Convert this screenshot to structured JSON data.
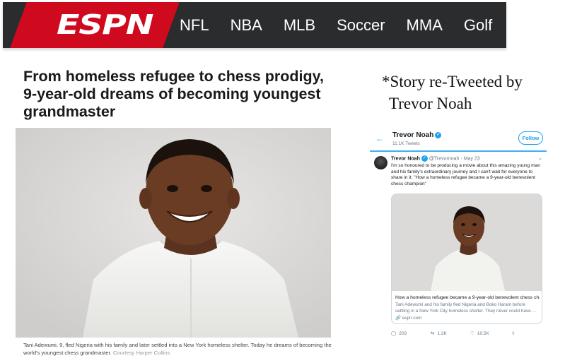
{
  "espn": {
    "logo": "ESPN",
    "nav": [
      "NFL",
      "NBA",
      "MLB",
      "Soccer",
      "MMA",
      "Golf"
    ],
    "brand_red": "#d00a1e",
    "bar_color": "#2b2c2d"
  },
  "article": {
    "headline": "From homeless refugee to chess prodigy, 9-year-old dreams of becoming youngest grandmaster",
    "caption": "Tani Adewumi, 9, fled Nigeria with his family and later settled into a New York homeless shelter. Today he dreams of becoming the world's youngest chess grandmaster.",
    "credit": "Courtesy Harper Collins"
  },
  "note": {
    "line1": "*Story re-Tweeted by",
    "line2": "Trevor Noah"
  },
  "tweet": {
    "profile_name": "Trevor Noah",
    "tweet_count": "11.1K Tweets",
    "follow_label": "Follow",
    "author": "Trevor Noah",
    "handle": "@Trevornoah",
    "date": "May 23",
    "text": "I'm so honoured to be producing a movie about this amazing young man and his family's extraordinary journey and I can't wait for everyone to share in it. \"How a homeless refugee became a 9-year-old benevolent chess champion\"",
    "card_title": "How a homeless refugee became a 9-year-old benevolent chess cha...",
    "card_desc": "Tani Adewumi and his family fled Nigeria and Boko Haram before settling in a New York City homeless shelter. They never could have ...",
    "card_link": "espn.com",
    "replies": "203",
    "retweets": "1.3K",
    "likes": "10.5K",
    "accent": "#1da1f2"
  }
}
